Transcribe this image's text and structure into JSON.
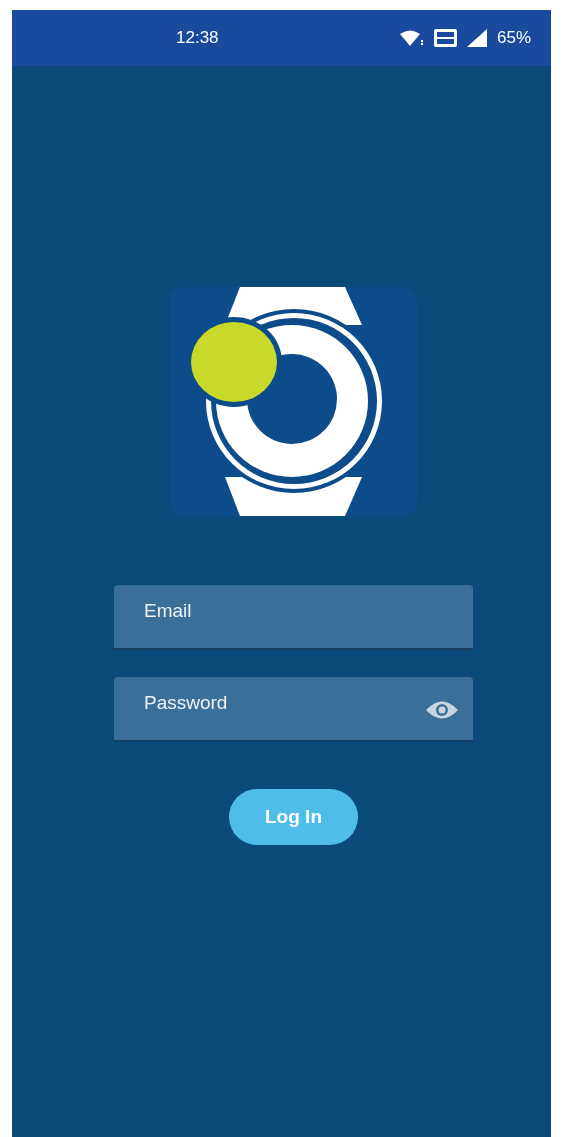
{
  "status_bar": {
    "time": "12:38",
    "battery": "65%"
  },
  "fields": [
    {
      "kind": "text",
      "placeholder": "Email"
    },
    {
      "kind": "password",
      "placeholder": "Password"
    }
  ],
  "login_button": {
    "label": "Log In"
  }
}
